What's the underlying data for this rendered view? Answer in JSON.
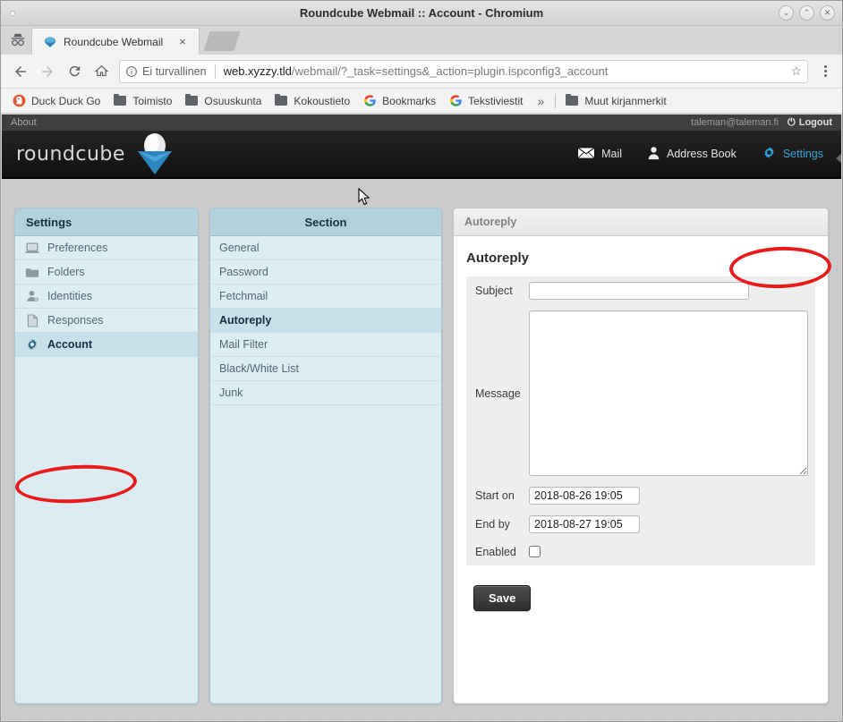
{
  "window": {
    "title": "Roundcube Webmail :: Account - Chromium",
    "controls": [
      {
        "name": "minimize",
        "glyph": "⌄"
      },
      {
        "name": "maximize",
        "glyph": "⌃"
      },
      {
        "name": "close",
        "glyph": "✕"
      }
    ]
  },
  "browser": {
    "incognito_icon": "incognito-icon",
    "tab": {
      "title": "Roundcube Webmail",
      "close_label": "×",
      "favicon": "roundcube-favicon"
    },
    "nav": {
      "back": "←",
      "forward": "→",
      "reload": "⟳",
      "home": "⌂"
    },
    "omnibox": {
      "security_text": "Ei turvallinen",
      "security_icon": "info-circle-icon",
      "url_host": "web.xyzzy.tld",
      "url_path": "/webmail/?_task=settings&_action=plugin.ispconfig3_account",
      "bookmark_star": "☆"
    },
    "menu_icon": "three-dots-menu-icon",
    "bookmarks": [
      {
        "label": "Duck Duck Go",
        "icon": "duckduckgo-icon"
      },
      {
        "label": "Toimisto",
        "icon": "folder-icon"
      },
      {
        "label": "Osuuskunta",
        "icon": "folder-icon"
      },
      {
        "label": "Kokoustieto",
        "icon": "folder-icon"
      },
      {
        "label": "Bookmarks",
        "icon": "google-icon"
      },
      {
        "label": "Tekstiviestit",
        "icon": "google-icon"
      }
    ],
    "bookmarks_overflow": "»",
    "bookmarks_other": {
      "label": "Muut kirjanmerkit",
      "icon": "folder-icon"
    }
  },
  "roundcube": {
    "topbar": {
      "about_label": "About",
      "user_email": "taleman@taleman.fi",
      "logout_label": "Logout",
      "logout_icon": "power-icon"
    },
    "logo_text": "roundcube",
    "nav": [
      {
        "label": "Mail",
        "icon": "envelope-icon",
        "active": false
      },
      {
        "label": "Address Book",
        "icon": "person-icon",
        "active": false
      },
      {
        "label": "Settings",
        "icon": "gear-icon",
        "active": true
      }
    ],
    "settings_panel": {
      "header": "Settings",
      "items": [
        {
          "label": "Preferences",
          "icon": "laptop-icon",
          "selected": false
        },
        {
          "label": "Folders",
          "icon": "folder-icon",
          "selected": false
        },
        {
          "label": "Identities",
          "icon": "identity-icon",
          "selected": false
        },
        {
          "label": "Responses",
          "icon": "document-icon",
          "selected": false
        },
        {
          "label": "Account",
          "icon": "gear-icon",
          "selected": true
        }
      ]
    },
    "section_panel": {
      "header": "Section",
      "items": [
        {
          "label": "General",
          "selected": false
        },
        {
          "label": "Password",
          "selected": false
        },
        {
          "label": "Fetchmail",
          "selected": false
        },
        {
          "label": "Autoreply",
          "selected": true
        },
        {
          "label": "Mail Filter",
          "selected": false
        },
        {
          "label": "Black/White List",
          "selected": false
        },
        {
          "label": "Junk",
          "selected": false
        }
      ]
    },
    "content_panel": {
      "header": "Autoreply",
      "title": "Autoreply",
      "fields": {
        "subject": {
          "label": "Subject",
          "value": "",
          "placeholder": ""
        },
        "message": {
          "label": "Message",
          "value": "",
          "placeholder": ""
        },
        "start_on": {
          "label": "Start on",
          "value": "2018-08-26 19:05"
        },
        "end_by": {
          "label": "End by",
          "value": "2018-08-27 19:05"
        },
        "enabled": {
          "label": "Enabled",
          "checked": false
        }
      },
      "save_label": "Save"
    }
  },
  "annotations": {
    "settings_nav_highlight": "red-ellipse-settings",
    "account_item_highlight": "red-ellipse-account",
    "color": "#e81a1a"
  }
}
